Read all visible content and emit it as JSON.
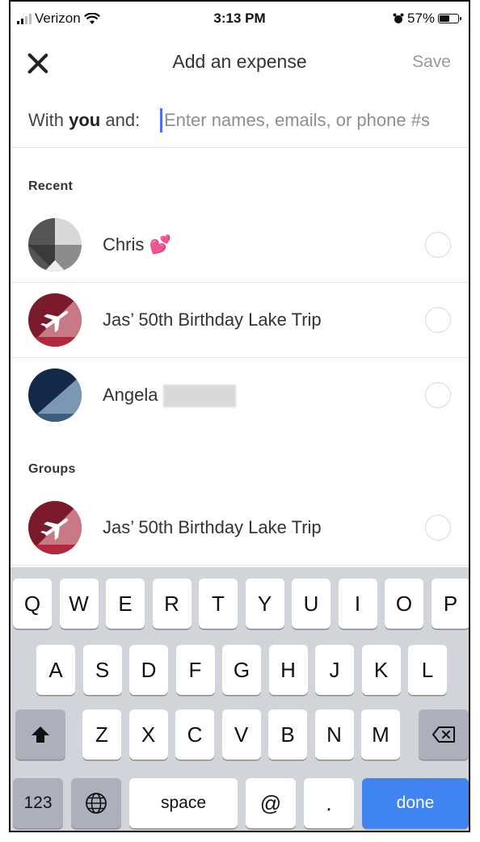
{
  "status_bar": {
    "carrier": "Verizon",
    "time": "3:13 PM",
    "battery": "57%",
    "battery_level": 0.57
  },
  "nav": {
    "title": "Add an expense",
    "save_label": "Save"
  },
  "with_row": {
    "prefix": "With ",
    "you": "you",
    "suffix": " and:",
    "placeholder": "Enter names, emails, or phone #s"
  },
  "recent": {
    "header": "Recent",
    "items": [
      {
        "name": "Chris",
        "emoji": "💕"
      },
      {
        "name": "Jas’ 50th Birthday Lake Trip"
      },
      {
        "name": "Angela"
      }
    ]
  },
  "groups": {
    "header": "Groups",
    "items": [
      {
        "name": "Jas’ 50th Birthday Lake Trip"
      }
    ]
  },
  "keyboard": {
    "row1": [
      "Q",
      "W",
      "E",
      "R",
      "T",
      "Y",
      "U",
      "I",
      "O",
      "P"
    ],
    "row2": [
      "A",
      "S",
      "D",
      "F",
      "G",
      "H",
      "J",
      "K",
      "L"
    ],
    "row3": [
      "Z",
      "X",
      "C",
      "V",
      "B",
      "N",
      "M"
    ],
    "numbers": "123",
    "space": "space",
    "at": "@",
    "period": ".",
    "done": "done"
  },
  "colors": {
    "accent_cursor": "#4f6df5",
    "done_key": "#3f84f0",
    "trip_avatar": "#7a1a2a",
    "angela_avatar": "#1d3a5c"
  },
  "icons": [
    "signal-icon",
    "wifi-icon",
    "alarm-icon",
    "battery-icon",
    "close-icon",
    "airplane-icon",
    "shift-icon",
    "backspace-icon",
    "globe-icon"
  ]
}
